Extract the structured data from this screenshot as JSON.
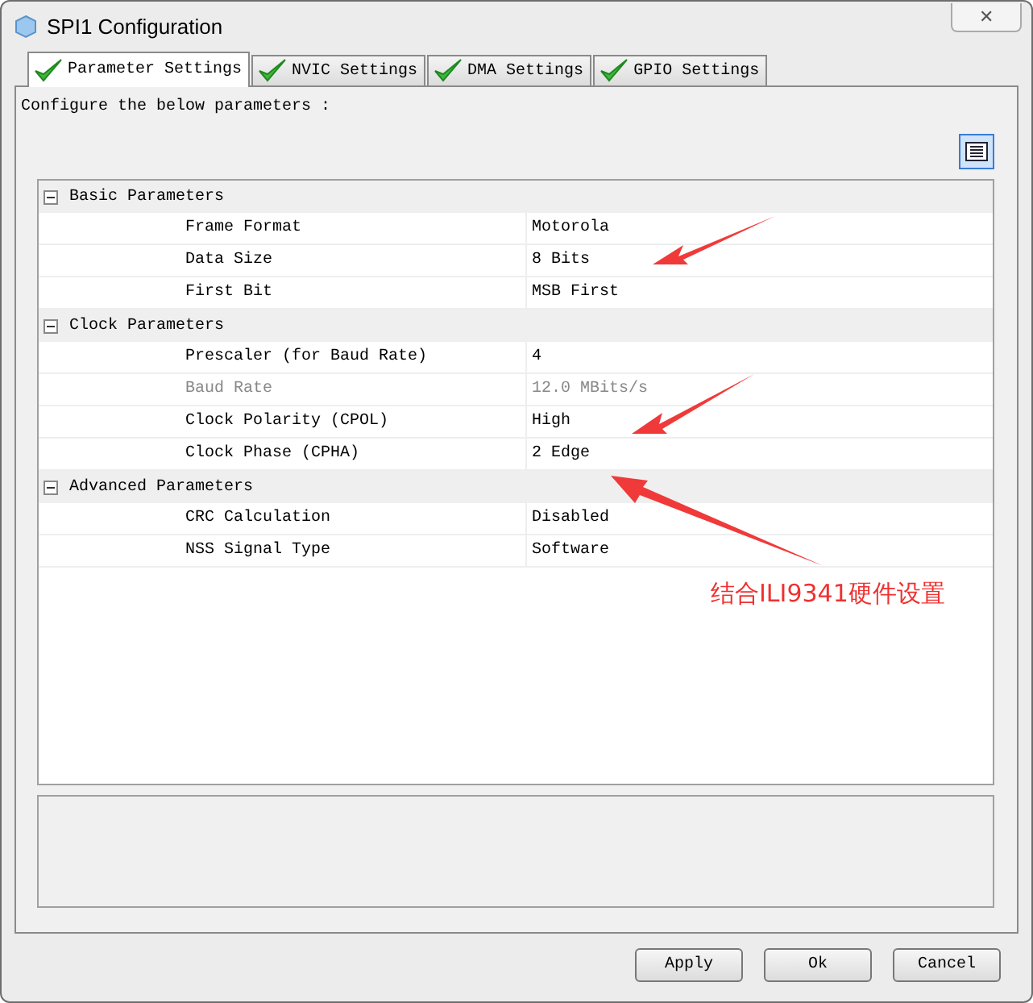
{
  "window": {
    "title": "SPI1 Configuration",
    "close": "✕"
  },
  "tabs": [
    {
      "label": "Parameter Settings",
      "selected": true
    },
    {
      "label": "NVIC Settings",
      "selected": false
    },
    {
      "label": "DMA Settings",
      "selected": false
    },
    {
      "label": "GPIO Settings",
      "selected": false
    }
  ],
  "instruction": "Configure the below parameters :",
  "groups": [
    {
      "name": "Basic Parameters",
      "expanded": true,
      "rows": [
        {
          "label": "Frame Format",
          "value": "Motorola",
          "disabled": false
        },
        {
          "label": "Data Size",
          "value": "8 Bits",
          "disabled": false
        },
        {
          "label": "First Bit",
          "value": "MSB First",
          "disabled": false
        }
      ]
    },
    {
      "name": "Clock Parameters",
      "expanded": true,
      "rows": [
        {
          "label": "Prescaler (for Baud Rate)",
          "value": "4",
          "disabled": false
        },
        {
          "label": "Baud Rate",
          "value": "12.0 MBits/s",
          "disabled": true
        },
        {
          "label": "Clock Polarity (CPOL)",
          "value": "High",
          "disabled": false
        },
        {
          "label": "Clock Phase (CPHA)",
          "value": "2 Edge",
          "disabled": false
        }
      ]
    },
    {
      "name": "Advanced Parameters",
      "expanded": true,
      "rows": [
        {
          "label": "CRC Calculation",
          "value": "Disabled",
          "disabled": false
        },
        {
          "label": "NSS Signal Type",
          "value": "Software",
          "disabled": false
        }
      ]
    }
  ],
  "annotation": {
    "text": "结合ILI9341硬件设置"
  },
  "buttons": [
    "Apply",
    "Ok",
    "Cancel"
  ]
}
